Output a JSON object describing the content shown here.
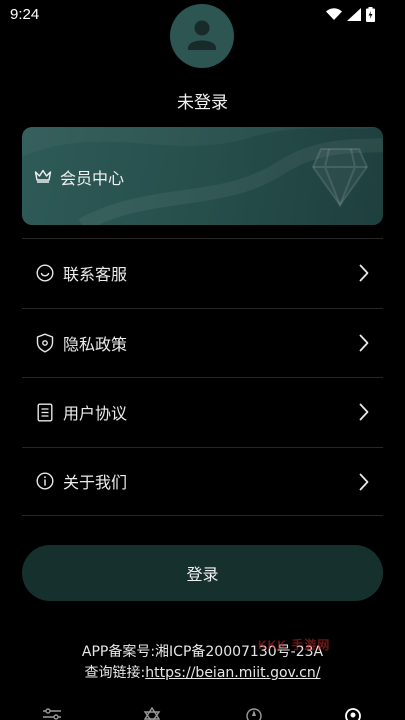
{
  "status_bar": {
    "time": "9:24",
    "icons": [
      "wifi-icon",
      "signal-icon",
      "battery-icon"
    ]
  },
  "profile": {
    "login_state": "未登录",
    "avatar_icon": "user-avatar-icon"
  },
  "member_card": {
    "label": "会员中心",
    "icon": "crown-icon",
    "decoration": "diamond-icon",
    "accent": "#2e5a57"
  },
  "menu": {
    "items": [
      {
        "label": "联系客服",
        "icon": "smile-icon"
      },
      {
        "label": "隐私政策",
        "icon": "shield-icon"
      },
      {
        "label": "用户协议",
        "icon": "document-icon"
      },
      {
        "label": "关于我们",
        "icon": "info-icon"
      }
    ]
  },
  "login_button": {
    "label": "登录"
  },
  "footer": {
    "icp_line": "APP备案号:湘ICP备20007130号-23A",
    "query_prefix": "查询链接:",
    "query_link": "https://beian.miit.gov.cn/",
    "watermark": "KKK 手游网"
  },
  "bottom_nav": {
    "items": [
      "sliders-icon",
      "star-of-david-icon",
      "compass-icon",
      "profile-icon"
    ]
  },
  "colors": {
    "background": "#000000",
    "card": "#2e5a57",
    "button": "#16302e",
    "divider": "#262626"
  }
}
